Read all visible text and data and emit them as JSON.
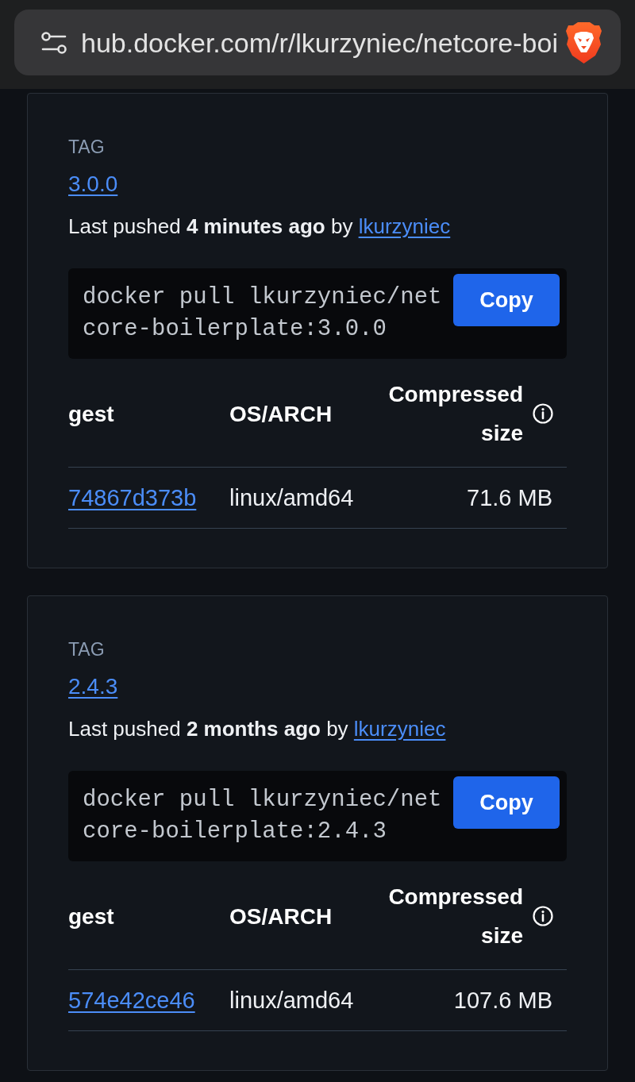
{
  "browser": {
    "url": "hub.docker.com/r/lkurzyniec/netcore-boi"
  },
  "tags": [
    {
      "label": "TAG",
      "version": "3.0.0",
      "pushed": "Last pushed **4 minutes ago** by",
      "user": "lkurzyniec",
      "command": "docker pull lkurzyniec/netcore-boilerplate:3.0.0",
      "copy_label": "Copy",
      "table": {
        "columns": [
          {
            "label": "gest",
            "info": false
          },
          {
            "label": "OS/ARCH",
            "info": false
          },
          {
            "label": "Compressed size",
            "info": true
          }
        ],
        "rows": [
          {
            "digest": "74867d373b",
            "os_arch": "linux/amd64",
            "size": "71.6 MB"
          }
        ]
      }
    },
    {
      "label": "TAG",
      "version": "2.4.3",
      "pushed": "Last pushed **2 months ago** by",
      "user": "lkurzyniec",
      "command": "docker pull lkurzyniec/netcore-boilerplate:2.4.3",
      "copy_label": "Copy",
      "table": {
        "columns": [
          {
            "label": "gest",
            "info": false
          },
          {
            "label": "OS/ARCH",
            "info": false
          },
          {
            "label": "Compressed size",
            "info": true
          }
        ],
        "rows": [
          {
            "digest": "574e42ce46",
            "os_arch": "linux/amd64",
            "size": "107.6 MB"
          }
        ]
      }
    }
  ]
}
